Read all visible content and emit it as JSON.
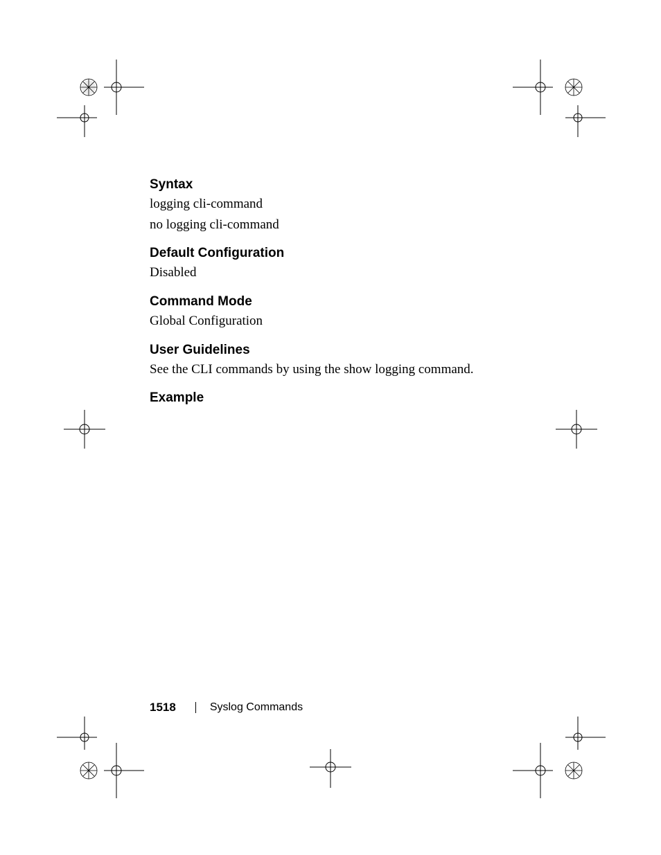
{
  "sections": {
    "syntax": {
      "heading": "Syntax",
      "line1": "logging cli-command",
      "line2": "no logging cli-command"
    },
    "defconf": {
      "heading": "Default Configuration",
      "body": "Disabled"
    },
    "cmdmode": {
      "heading": "Command Mode",
      "body": "Global Configuration"
    },
    "guidelines": {
      "heading": "User Guidelines",
      "body": "See the CLI commands by using the show logging command."
    },
    "example": {
      "heading": "Example"
    }
  },
  "footer": {
    "page_number": "1518",
    "section_title": "Syslog Commands"
  }
}
